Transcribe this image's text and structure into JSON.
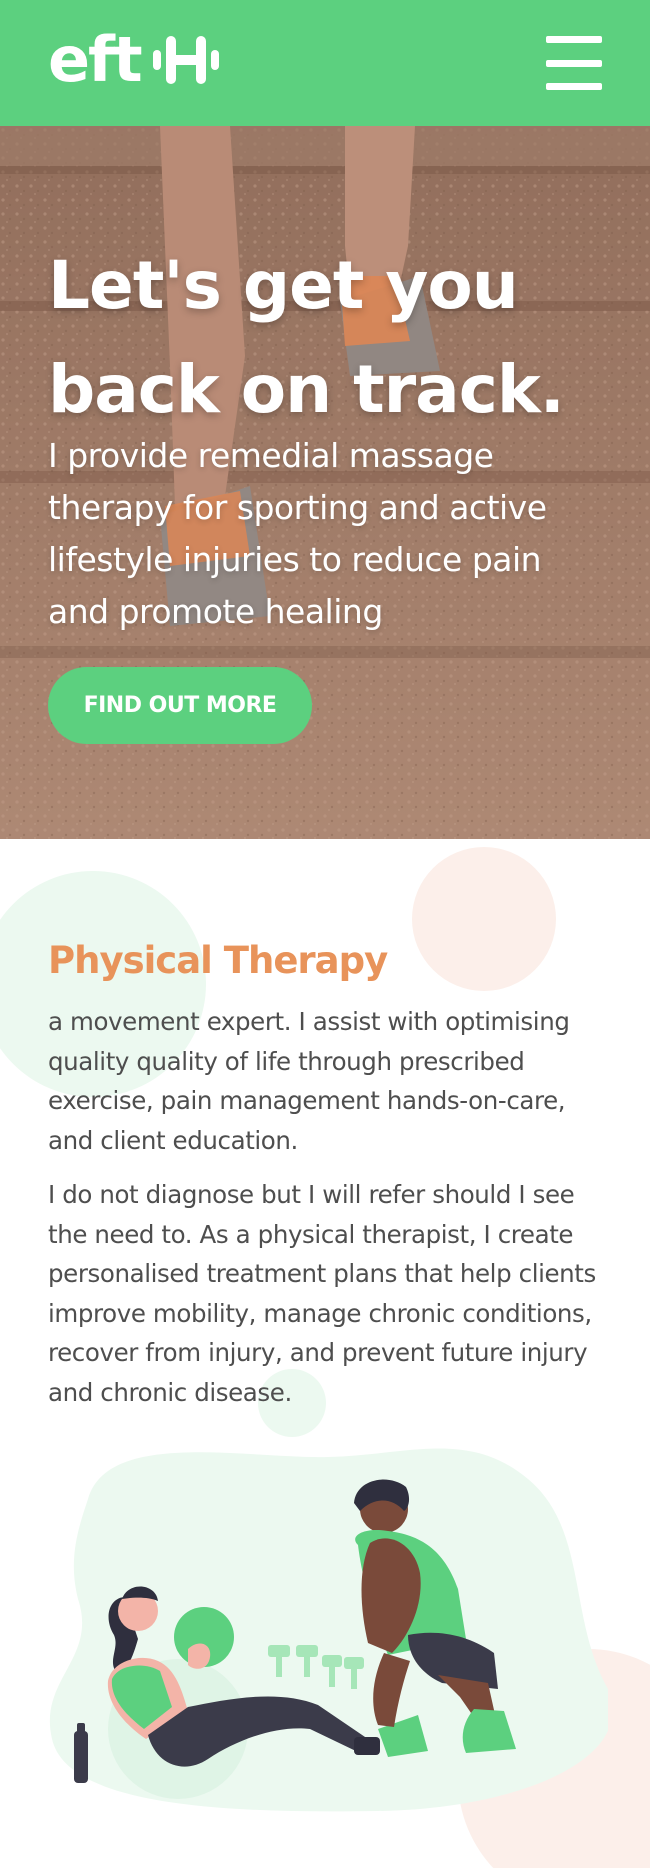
{
  "header": {
    "logo_text": "eft",
    "logo_icon": "dumbbell-icon",
    "menu_icon": "hamburger-menu-icon",
    "brand_color": "#5cd07f"
  },
  "hero": {
    "title": "Let's get you back on track.",
    "text": "I provide remedial massage therapy for sporting and active lifestyle injuries to reduce pain and promote healing",
    "cta_label": "FIND OUT MORE",
    "background": "photo-running-shoes-on-stairs"
  },
  "therapy": {
    "title": "Physical Therapy",
    "title_color": "#e8935a",
    "paragraphs": [
      "a movement expert. I assist with optimising quality quality of life through prescribed exercise, pain management hands-on-care, and client education.",
      "I do not diagnose but I will refer should I see the need to. As a physical therapist, I create personalised treatment plans that help clients improve mobility, manage chronic conditions, recover from injury, and prevent future injury and chronic disease."
    ],
    "illustration": "trainer-with-client-exercise-illustration"
  }
}
